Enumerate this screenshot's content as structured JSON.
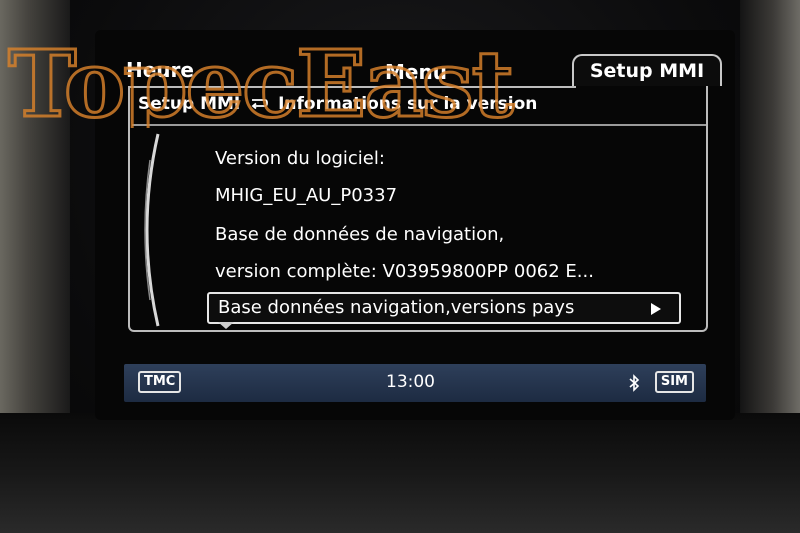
{
  "tabs": {
    "heure": "Heure",
    "menu": "Menu",
    "setup": "Setup MMI"
  },
  "breadcrumb": {
    "parent": "Setup MMI",
    "separator_icon": "return-arrow-icon",
    "current": "Informations sur la version"
  },
  "content": {
    "rows": [
      "Version du logiciel:",
      "MHIG_EU_AU_P0337",
      "Base de données de navigation,",
      "version complète: V03959800PP 0062 E..."
    ],
    "selected_item": "Base données navigation,versions pays"
  },
  "status_bar": {
    "tmc": "TMC",
    "time": "13:00",
    "bluetooth_icon": "bluetooth-icon",
    "sim": "SIM"
  },
  "watermark": {
    "text": "TopecEast"
  },
  "colors": {
    "status_bar": "#24344f",
    "watermark": "#d9822b",
    "text": "#ffffff"
  }
}
